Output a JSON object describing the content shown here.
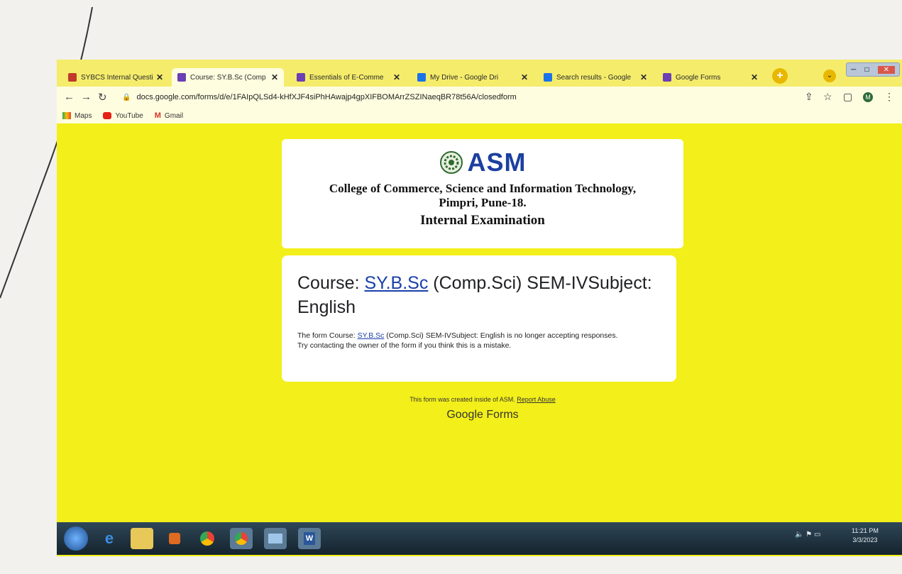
{
  "browser": {
    "tabs": [
      {
        "label": "SYBCS Internal Questio",
        "fav_color": "#c0392b",
        "active": false
      },
      {
        "label": "Course: SY.B.Sc (Comp",
        "fav_color": "#6b3fb5",
        "active": true
      },
      {
        "label": "Essentials of E-Comme",
        "fav_color": "#6b3fb5",
        "active": false
      },
      {
        "label": "My Drive - Google Dri",
        "fav_color": "#1a73e8",
        "active": false
      },
      {
        "label": "Search results - Google",
        "fav_color": "#1a73e8",
        "active": false
      },
      {
        "label": "Google Forms",
        "fav_color": "#6b3fb5",
        "active": false
      }
    ],
    "close_glyph": "✕",
    "new_tab_glyph": "+",
    "url": "docs.google.com/forms/d/e/1FAIpQLSd4-kHfXJF4siPhHAwajp4gpXIFBOMArrZSZINaeqBR78t56A/closedform",
    "avatar_letter": "M",
    "bookmarks": [
      {
        "label": "Maps",
        "icon": "maps-icon"
      },
      {
        "label": "YouTube",
        "icon": "youtube-icon"
      },
      {
        "label": "Gmail",
        "icon": "gmail-icon"
      }
    ]
  },
  "header": {
    "logo_text": "ASM",
    "college_line1": "College of Commerce, Science and Information Technology,",
    "college_line2": "Pimpri, Pune-18.",
    "exam_title": "Internal Examination"
  },
  "form": {
    "title_prefix": "Course: ",
    "title_link": "SY.B.Sc",
    "title_suffix": " (Comp.Sci) SEM-IVSubject: English",
    "msg_prefix": "The form Course: ",
    "msg_link": "SY.B.Sc",
    "msg_suffix": " (Comp.Sci) SEM-IVSubject: English is no longer accepting responses.",
    "msg_line2": "Try contacting the owner of the form if you think this is a mistake."
  },
  "footer": {
    "created_text": "This form was created inside of ASM. ",
    "report_link": "Report Abuse",
    "brand": "Google Forms"
  },
  "taskbar": {
    "time": "11:21 PM",
    "date": "3/3/2023"
  },
  "colors": {
    "page_background": "#f3ef1a",
    "link": "#1a3faa",
    "logo": "#1c3fa0"
  }
}
